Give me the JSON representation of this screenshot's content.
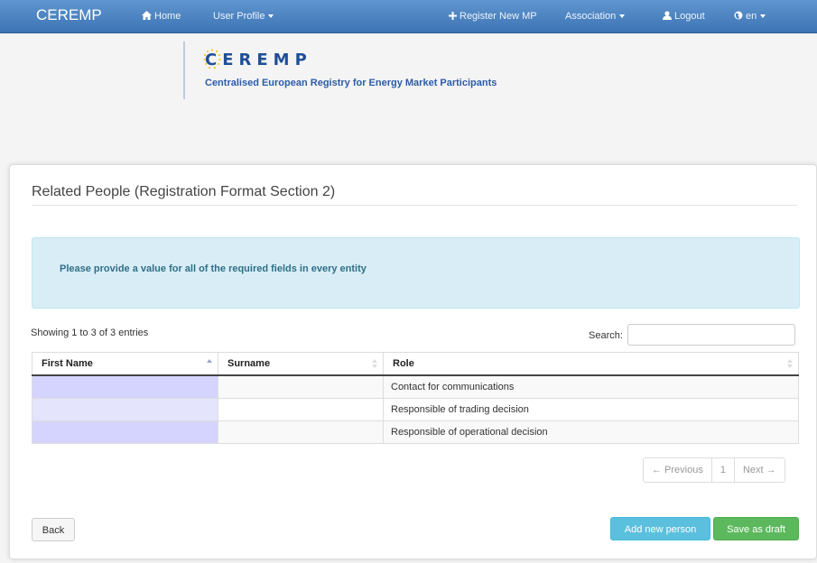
{
  "navbar": {
    "brand": "CEREMP",
    "home": "Home",
    "user_profile": "User Profile",
    "register": "Register New MP",
    "association": "Association",
    "logout": "Logout",
    "language": "en"
  },
  "logo": {
    "mark": "CEREMP",
    "subtitle": "Centralised European Registry for Energy Market Participants"
  },
  "panel": {
    "title": "Related People (Registration Format Section 2)",
    "alert": "Please provide a value for all of the required fields in every entity"
  },
  "table": {
    "info": "Showing 1 to 3 of 3 entries",
    "search_label": "Search:",
    "search_value": "",
    "columns": [
      "First Name",
      "Surname",
      "Role"
    ],
    "rows": [
      {
        "first_name": "",
        "surname": "",
        "role": "Contact for communications"
      },
      {
        "first_name": "",
        "surname": "",
        "role": "Responsible of trading decision"
      },
      {
        "first_name": "",
        "surname": "",
        "role": "Responsible of operational decision"
      }
    ]
  },
  "pagination": {
    "previous": "← Previous",
    "page": "1",
    "next": "Next →"
  },
  "buttons": {
    "back": "Back",
    "add": "Add new person",
    "save": "Save as draft"
  },
  "colors": {
    "navbar": "#4a82c2",
    "alert_bg": "#d9edf7",
    "add_button": "#5bc0de",
    "save_button": "#5cb85c",
    "first_name_cell": "#d4d4ff"
  },
  "icons": [
    "home-icon",
    "plus-icon",
    "user-icon",
    "globe-icon",
    "caret-down-icon"
  ]
}
